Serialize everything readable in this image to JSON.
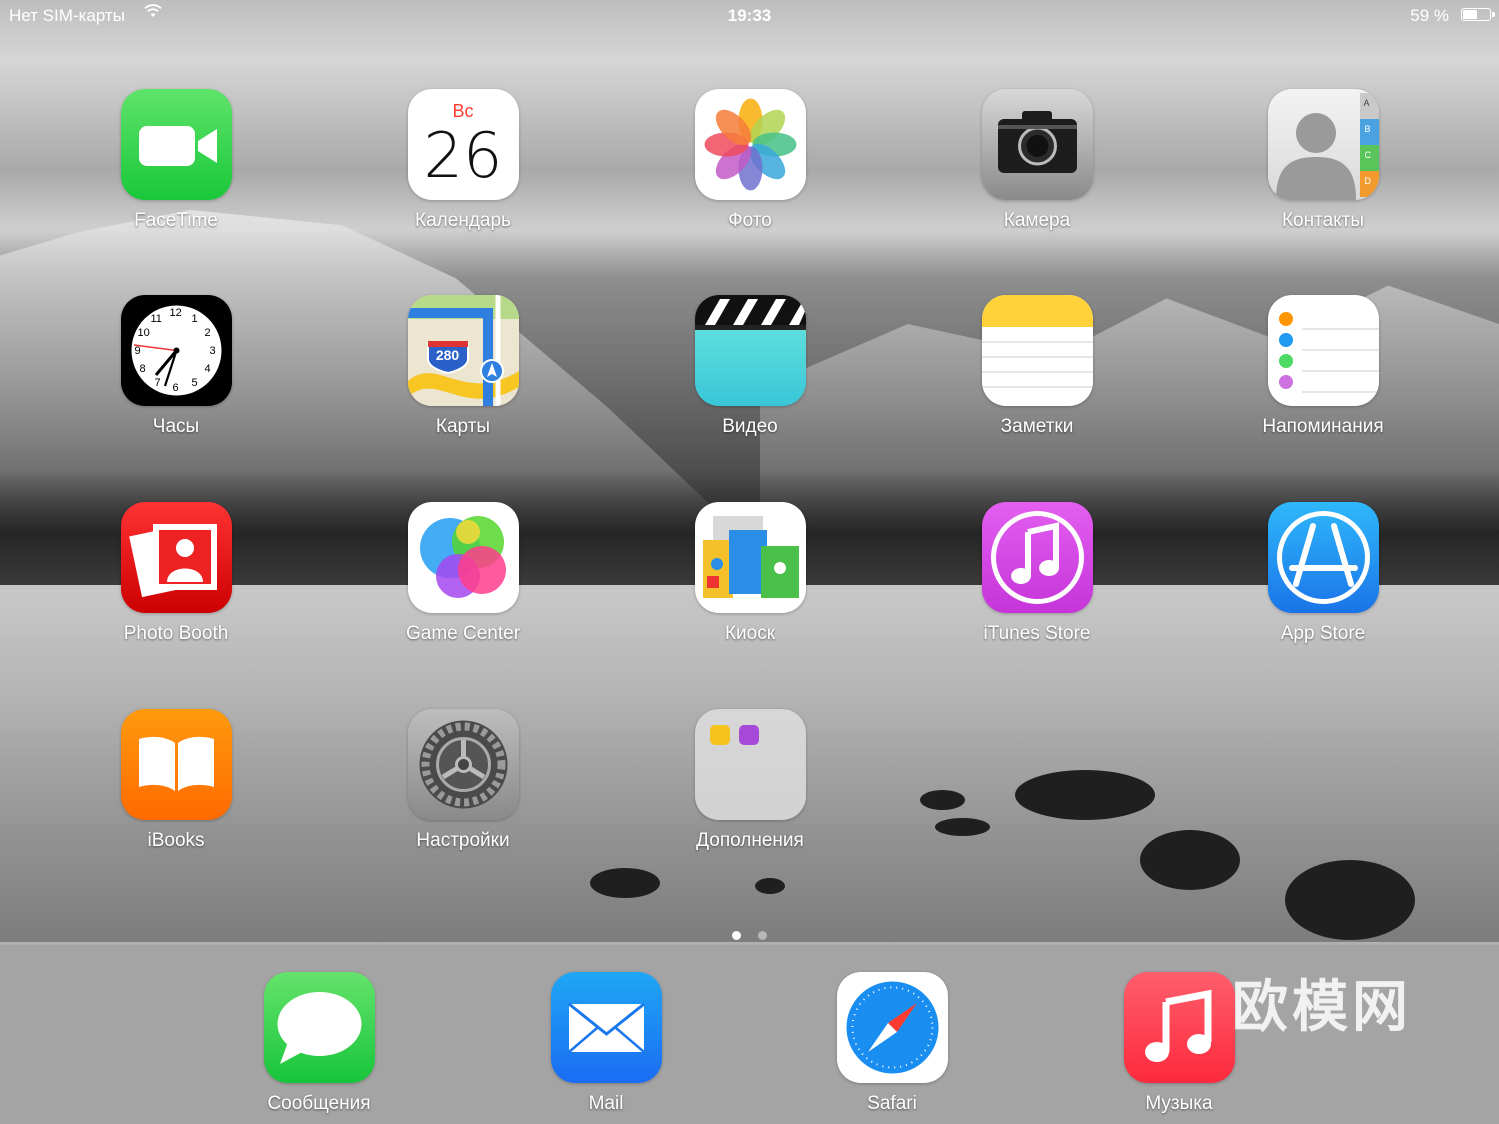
{
  "status_bar": {
    "carrier": "Нет SIM-карты",
    "time": "19:33",
    "battery_percent": "59 %",
    "battery_level": 0.59,
    "wifi_icon": "wifi-icon"
  },
  "apps": {
    "facetime": "FaceTime",
    "calendar": "Календарь",
    "calendar_dow": "Вс",
    "calendar_day": "26",
    "photos": "Фото",
    "camera": "Камера",
    "contacts": "Контакты",
    "contacts_tabs": [
      "A",
      "B",
      "C",
      "D"
    ],
    "clock": "Часы",
    "clock_numbers": [
      "12",
      "1",
      "2",
      "3",
      "4",
      "5",
      "6",
      "7",
      "8",
      "9",
      "10",
      "11"
    ],
    "maps": "Карты",
    "maps_shield": "280",
    "videos": "Видео",
    "notes": "Заметки",
    "reminders": "Напоминания",
    "photo_booth": "Photo Booth",
    "game_center": "Game Center",
    "kiosk": "Киоск",
    "itunes_store": "iTunes Store",
    "app_store": "App Store",
    "ibooks": "iBooks",
    "settings": "Настройки",
    "extras_folder": "Дополнения"
  },
  "dock": {
    "messages": "Сообщения",
    "mail": "Mail",
    "safari": "Safari",
    "music": "Музыка"
  },
  "page_indicator": {
    "pages": 2,
    "current": 1
  },
  "watermark": "欧模网"
}
